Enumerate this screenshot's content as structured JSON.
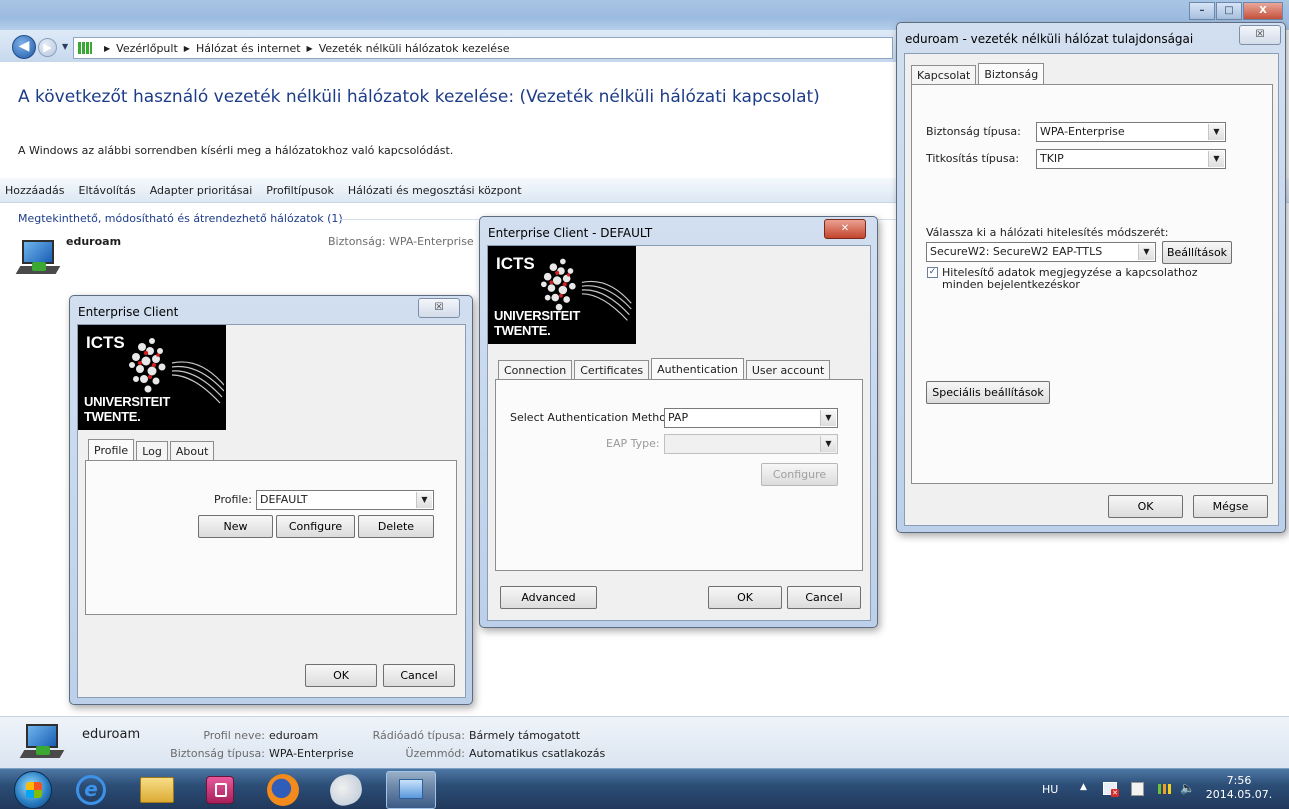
{
  "explorer": {
    "breadcrumb": [
      "Vezérlőpult",
      "Hálózat és internet",
      "Vezeték nélküli hálózatok kezelése"
    ],
    "page_title": "A következőt használó vezeték nélküli hálózatok kezelése: (Vezeték nélküli hálózati kapcsolat)",
    "page_desc": "A Windows az alábbi sorrendben kísérli meg a hálózatokhoz való kapcsolódást.",
    "commands": [
      "Hozzáadás",
      "Eltávolítás",
      "Adapter prioritásai",
      "Profiltípusok",
      "Hálózati és megosztási központ"
    ],
    "group_header": "Megtekinthető, módosítható és átrendezhető hálózatok (1)",
    "network": {
      "name": "eduroam",
      "security": "Biztonság: WPA-Enterprise"
    },
    "details": {
      "name": "eduroam",
      "profile_label": "Profil neve:",
      "profile_value": "eduroam",
      "security_label": "Biztonság típusa:",
      "security_value": "WPA-Enterprise",
      "radio_label": "Rádióadó típusa:",
      "radio_value": "Bármely támogatott",
      "mode_label": "Üzemmód:",
      "mode_value": "Automatikus csatlakozás"
    }
  },
  "enterprise_client": {
    "title": "Enterprise Client",
    "close_glyph": "☒",
    "logo_top": "ICTS",
    "logo_bottom": "UNIVERSITEIT TWENTE.",
    "tabs": [
      "Profile",
      "Log",
      "About"
    ],
    "profile_label": "Profile:",
    "profile_value": "DEFAULT",
    "buttons": {
      "new": "New",
      "configure": "Configure",
      "delete": "Delete",
      "ok": "OK",
      "cancel": "Cancel"
    }
  },
  "enterprise_default": {
    "title": "Enterprise Client - DEFAULT",
    "close_glyph": "✕",
    "logo_top": "ICTS",
    "logo_bottom": "UNIVERSITEIT TWENTE.",
    "tabs": [
      "Connection",
      "Certificates",
      "Authentication",
      "User account"
    ],
    "auth_method_label": "Select Authentication Method:",
    "auth_method_value": "PAP",
    "eap_type_label": "EAP Type:",
    "eap_type_value": "",
    "buttons": {
      "configure": "Configure",
      "advanced": "Advanced",
      "ok": "OK",
      "cancel": "Cancel"
    }
  },
  "eduroam_props": {
    "title": "eduroam - vezeték nélküli hálózat tulajdonságai",
    "close_glyph": "☒",
    "tabs": [
      "Kapcsolat",
      "Biztonság"
    ],
    "security_type_label": "Biztonság típusa:",
    "security_type_value": "WPA-Enterprise",
    "encryption_label": "Titkosítás típusa:",
    "encryption_value": "TKIP",
    "auth_method_label": "Válassza ki a hálózati hitelesítés módszerét:",
    "auth_method_value": "SecureW2: SecureW2 EAP-TTLS",
    "settings_button": "Beállítások",
    "remember_checkbox": "Hitelesítő adatok megjegyzése a kapcsolathoz",
    "remember_checkbox_line2": "minden bejelentkezéskor",
    "advanced_button": "Speciális beállítások",
    "ok": "OK",
    "cancel": "Mégse"
  },
  "window_caption": {
    "minimize": "–",
    "maximize": "□",
    "close": "X"
  },
  "taskbar": {
    "language": "HU",
    "time": "7:56",
    "date": "2014.05.07."
  }
}
